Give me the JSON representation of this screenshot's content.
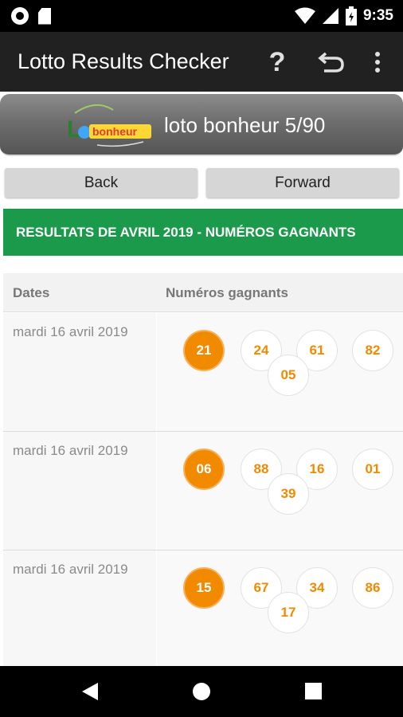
{
  "status_bar": {
    "time": "9:35"
  },
  "app_bar": {
    "title": "Lotto Results Checker",
    "help_label": "?"
  },
  "banner": {
    "title": "loto bonheur 5/90",
    "logo_text": "bonheur"
  },
  "nav": {
    "back_label": "Back",
    "forward_label": "Forward"
  },
  "results": {
    "heading": "RESULTATS DE AVRIL 2019 - NUMÉROS GAGNANTS",
    "columns": {
      "dates": "Dates",
      "numbers": "Numéros gagnants"
    },
    "rows": [
      {
        "date": "mardi 16 avril 2019",
        "main": "21",
        "numbers": [
          "24",
          "61",
          "82",
          "05"
        ]
      },
      {
        "date": "mardi 16 avril 2019",
        "main": "06",
        "numbers": [
          "88",
          "16",
          "01",
          "39"
        ]
      },
      {
        "date": "mardi 16 avril 2019",
        "main": "15",
        "numbers": [
          "67",
          "34",
          "86",
          "17"
        ]
      }
    ]
  },
  "colors": {
    "accent_green": "#1a9a4a",
    "ball_orange": "#f28a00",
    "app_bar": "#212121"
  }
}
